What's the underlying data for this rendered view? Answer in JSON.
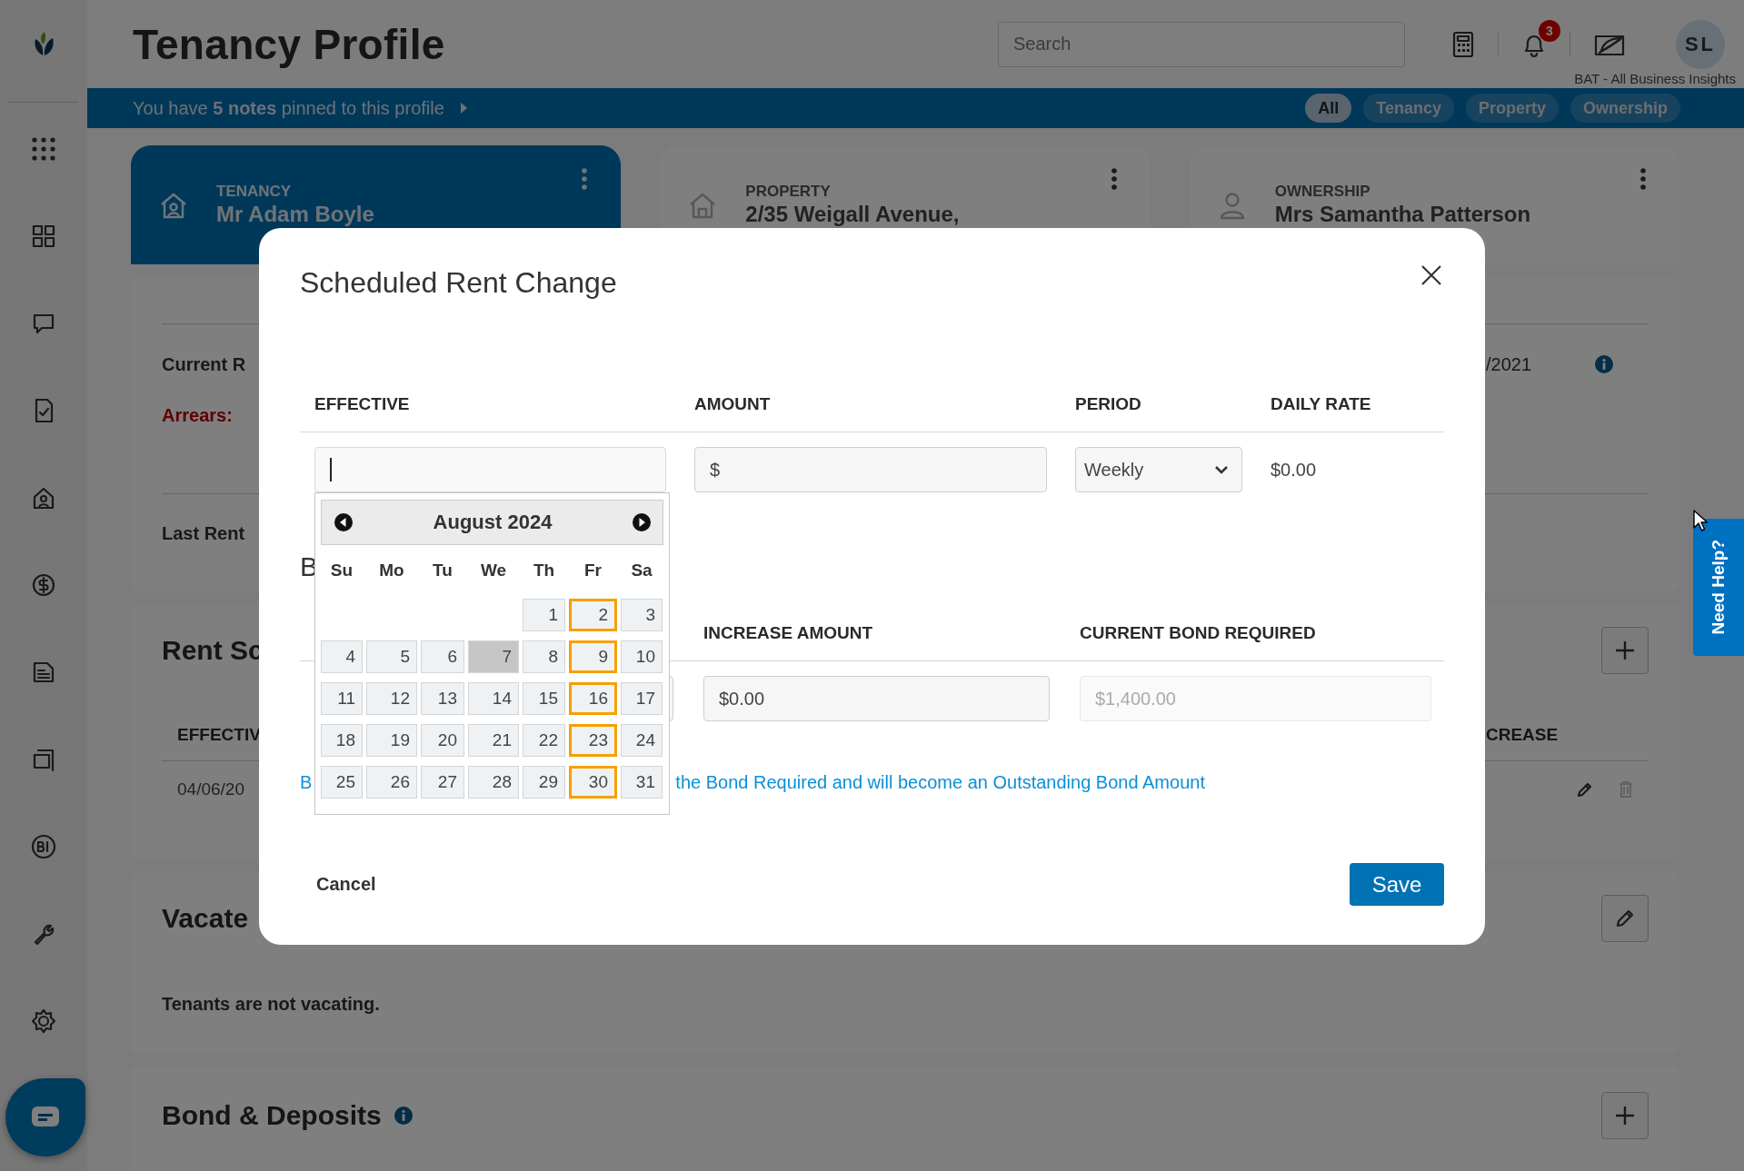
{
  "header": {
    "title": "Tenancy Profile",
    "search": {
      "placeholder": "Search"
    },
    "notification_count": "3",
    "avatar_initials": "SL",
    "insights_caption": "BAT - All Business Insights"
  },
  "notes_bar": {
    "message": "You have **5 notes** pinned to this profile",
    "filters": [
      {
        "label": "All",
        "selected": true
      },
      {
        "label": "Tenancy",
        "selected": false
      },
      {
        "label": "Property",
        "selected": false
      },
      {
        "label": "Ownership",
        "selected": false
      }
    ]
  },
  "profile_cards": [
    {
      "kind": "tenancy",
      "label": "TENANCY",
      "lines": [
        "Mr Adam Boyle"
      ],
      "selected": true
    },
    {
      "kind": "property",
      "label": "PROPERTY",
      "lines": [
        "2/35 Weigall Avenue,"
      ],
      "selected": false
    },
    {
      "kind": "ownership",
      "label": "OWNERSHIP",
      "lines": [
        "Mrs Samantha Patterson"
      ],
      "selected": false
    }
  ],
  "rent_card": {
    "rows": [
      {
        "label": "Current R",
        "kind": "plain",
        "value": "/2021",
        "info": true
      },
      {
        "label": "Arrears:",
        "kind": "alert",
        "info": false
      }
    ],
    "footer_label": "Last Rent"
  },
  "rent_schedule": {
    "title": "Rent Sc",
    "columns": [
      "EFFECTIV",
      "CREASE"
    ],
    "rows": [
      {
        "cells": [
          "04/06/20"
        ],
        "delete_disabled": true
      }
    ]
  },
  "vacate": {
    "title": "Vacate",
    "text": "Tenants are not vacating."
  },
  "bond_deposits": {
    "title": "Bond & Deposits"
  },
  "modal": {
    "title": "Scheduled Rent Change",
    "columns": [
      "EFFECTIVE",
      "AMOUNT",
      "PERIOD",
      "DAILY RATE"
    ],
    "effective": {
      "focused": true
    },
    "amount": {
      "prefix": "$"
    },
    "period": {
      "value": "Weekly"
    },
    "daily_rate": "$0.00",
    "bond_heading": "B",
    "bond_columns": [
      "INCREASE AMOUNT",
      "CURRENT BOND REQUIRED"
    ],
    "increase_amount": {
      "value": "$0.00"
    },
    "current_bond": {
      "value": "$1,400.00",
      "disabled": true
    },
    "note": [
      "B",
      "the Bond Required and will become an Outstanding Bond Amount"
    ],
    "cancel": "Cancel",
    "save": "Save",
    "calendar": {
      "month": "August 2024",
      "weekdays": [
        "Su",
        "Mo",
        "Tu",
        "We",
        "Th",
        "Fr",
        "Sa"
      ],
      "weeks": [
        [
          {
            "day": "1",
            "today": false,
            "highlighted": false
          },
          {
            "day": "2",
            "today": false,
            "highlighted": true
          },
          {
            "day": "3",
            "today": false,
            "highlighted": false
          }
        ],
        [
          {
            "day": "4",
            "today": false,
            "highlighted": false
          },
          {
            "day": "5",
            "today": false,
            "highlighted": false
          },
          {
            "day": "6",
            "today": false,
            "highlighted": false
          },
          {
            "day": "7",
            "today": true,
            "highlighted": false
          },
          {
            "day": "8",
            "today": false,
            "highlighted": false
          },
          {
            "day": "9",
            "today": false,
            "highlighted": true
          },
          {
            "day": "10",
            "today": false,
            "highlighted": false
          }
        ],
        [
          {
            "day": "11",
            "today": false,
            "highlighted": false
          },
          {
            "day": "12",
            "today": false,
            "highlighted": false
          },
          {
            "day": "13",
            "today": false,
            "highlighted": false
          },
          {
            "day": "14",
            "today": false,
            "highlighted": false
          },
          {
            "day": "15",
            "today": false,
            "highlighted": false
          },
          {
            "day": "16",
            "today": false,
            "highlighted": true
          },
          {
            "day": "17",
            "today": false,
            "highlighted": false
          }
        ],
        [
          {
            "day": "18",
            "today": false,
            "highlighted": false
          },
          {
            "day": "19",
            "today": false,
            "highlighted": false
          },
          {
            "day": "20",
            "today": false,
            "highlighted": false
          },
          {
            "day": "21",
            "today": false,
            "highlighted": false
          },
          {
            "day": "22",
            "today": false,
            "highlighted": false
          },
          {
            "day": "23",
            "today": false,
            "highlighted": true
          },
          {
            "day": "24",
            "today": false,
            "highlighted": false
          }
        ],
        [
          {
            "day": "25",
            "today": false,
            "highlighted": false
          },
          {
            "day": "26",
            "today": false,
            "highlighted": false
          },
          {
            "day": "27",
            "today": false,
            "highlighted": false
          },
          {
            "day": "28",
            "today": false,
            "highlighted": false
          },
          {
            "day": "29",
            "today": false,
            "highlighted": false
          },
          {
            "day": "30",
            "today": false,
            "highlighted": true
          },
          {
            "day": "31",
            "today": false,
            "highlighted": false
          }
        ]
      ]
    }
  },
  "help_tab": {
    "label": "Need Help?"
  }
}
